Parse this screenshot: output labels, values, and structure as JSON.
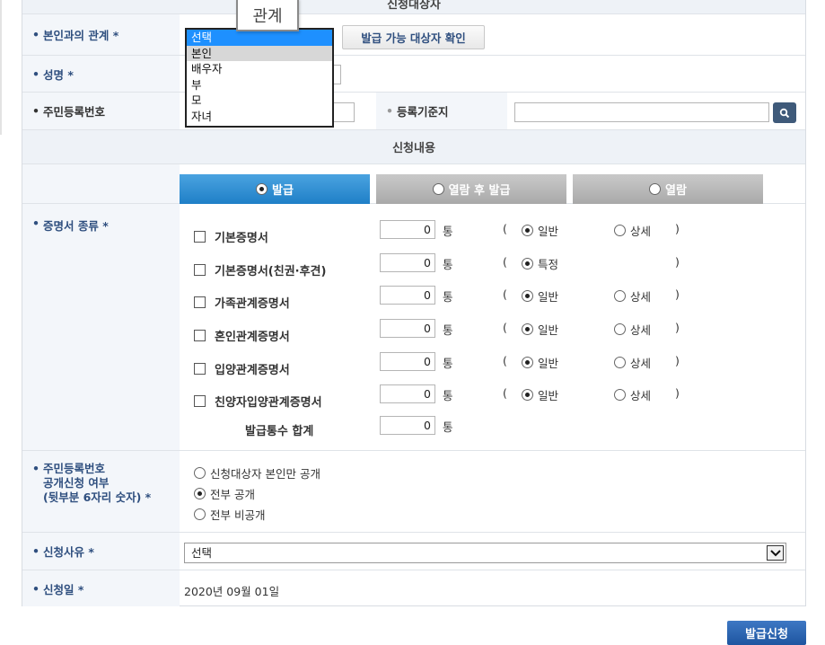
{
  "header": {
    "section_top_title": "신청대상자",
    "tooltip": "관계"
  },
  "fields": {
    "relation": {
      "label": "본인과의 관계 *",
      "options": [
        "선택",
        "본인",
        "배우자",
        "부",
        "모",
        "자녀"
      ],
      "selected": "선택",
      "hover": "본인",
      "check_button": "발급 가능 대상자 확인"
    },
    "name": {
      "label": "성명 *"
    },
    "rrn": {
      "label": "주민등록번호"
    },
    "reg_base": {
      "label": "등록기준지"
    }
  },
  "section2_title": "신청내용",
  "tabs": [
    {
      "label": "발급",
      "active": true
    },
    {
      "label": "열람 후 발급",
      "active": false
    },
    {
      "label": "열람",
      "active": false
    }
  ],
  "certificates": {
    "label": "증명서 종류 *",
    "unit": "통",
    "items": [
      {
        "name": "기본증명서",
        "qty": "0",
        "opt1": "일반",
        "opt2": "상세"
      },
      {
        "name": "기본증명서(친권·후견)",
        "qty": "0",
        "opt1": "특정",
        "opt2": ""
      },
      {
        "name": "가족관계증명서",
        "qty": "0",
        "opt1": "일반",
        "opt2": "상세"
      },
      {
        "name": "혼인관계증명서",
        "qty": "0",
        "opt1": "일반",
        "opt2": "상세"
      },
      {
        "name": "입양관계증명서",
        "qty": "0",
        "opt1": "일반",
        "opt2": "상세"
      },
      {
        "name": "친양자입양관계증명서",
        "qty": "0",
        "opt1": "일반",
        "opt2": "상세"
      }
    ],
    "total_label": "발급통수 합계",
    "total_qty": "0"
  },
  "disclosure": {
    "label_line1": "주민등록번호",
    "label_line2": "공개신청 여부",
    "label_line3": "(뒷부분 6자리 숫자) *",
    "options": [
      "신청대상자 본인만 공개",
      "전부 공개",
      "전부 비공개"
    ],
    "selected_index": 1
  },
  "reason": {
    "label": "신청사유 *",
    "value": "선택"
  },
  "date": {
    "label": "신청일 *",
    "value": "2020년 09월 01일"
  },
  "submit_label": "발급신청",
  "colors": {
    "tab_active": "#1f7fc7",
    "tab_inactive": "#a9a9a9",
    "label_text": "#2f4f7f",
    "submit": "#1e55a0"
  }
}
